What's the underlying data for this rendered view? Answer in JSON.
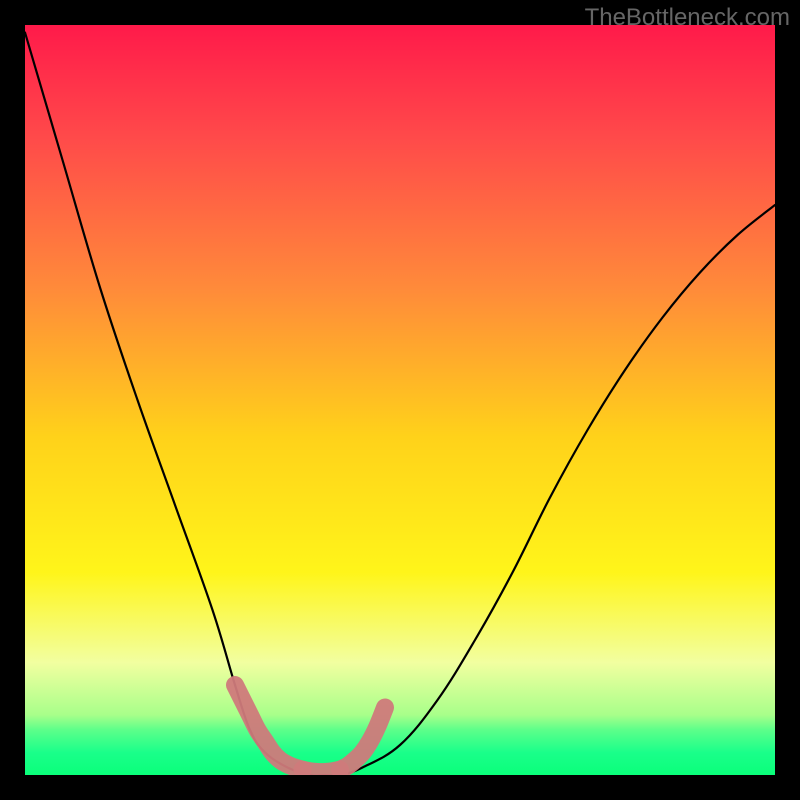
{
  "watermark": "TheBottleneck.com",
  "chart_data": {
    "type": "line",
    "title": "",
    "xlabel": "",
    "ylabel": "",
    "xlim": [
      0,
      100
    ],
    "ylim": [
      0,
      100
    ],
    "series": [
      {
        "name": "curve",
        "x": [
          0,
          5,
          10,
          15,
          20,
          25,
          28,
          30,
          32,
          35,
          38,
          40,
          42,
          45,
          50,
          55,
          60,
          65,
          70,
          75,
          80,
          85,
          90,
          95,
          100
        ],
        "values": [
          99,
          82,
          65,
          50,
          36,
          22,
          12,
          6,
          3,
          1,
          0,
          0,
          0,
          1,
          4,
          10,
          18,
          27,
          37,
          46,
          54,
          61,
          67,
          72,
          76
        ],
        "color": "#000000"
      },
      {
        "name": "highlight-segment-left",
        "x": [
          28,
          29,
          30,
          31,
          32,
          33,
          34,
          35,
          36,
          37
        ],
        "values": [
          12,
          10,
          8,
          6,
          4.5,
          3,
          2,
          1.4,
          1,
          0.7
        ],
        "color": "#cf7a7b"
      },
      {
        "name": "highlight-segment-bottom",
        "x": [
          37,
          38,
          39,
          40,
          41,
          42
        ],
        "values": [
          0.7,
          0.5,
          0.4,
          0.4,
          0.5,
          0.7
        ],
        "color": "#cf7a7b"
      },
      {
        "name": "highlight-segment-right",
        "x": [
          42,
          43,
          44,
          45,
          46,
          47,
          48
        ],
        "values": [
          0.7,
          1.2,
          2,
          3,
          4.5,
          6.5,
          9
        ],
        "color": "#cf7a7b"
      }
    ],
    "gradient_bg": {
      "stops": [
        {
          "offset": 0.0,
          "color": "#ff1a4a"
        },
        {
          "offset": 0.15,
          "color": "#ff4a4a"
        },
        {
          "offset": 0.35,
          "color": "#ff8a3a"
        },
        {
          "offset": 0.55,
          "color": "#ffd21a"
        },
        {
          "offset": 0.73,
          "color": "#fff51a"
        },
        {
          "offset": 0.85,
          "color": "#f2ffa0"
        },
        {
          "offset": 0.92,
          "color": "#a8ff8a"
        },
        {
          "offset": 0.94,
          "color": "#5cff8a"
        },
        {
          "offset": 0.97,
          "color": "#1aff8a"
        },
        {
          "offset": 1.0,
          "color": "#0aff7a"
        }
      ]
    }
  }
}
